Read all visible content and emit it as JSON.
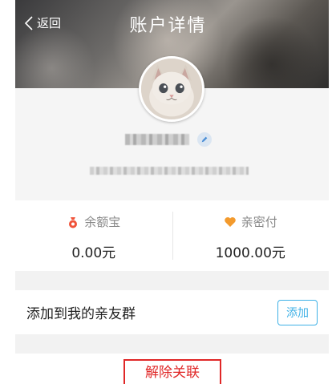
{
  "header": {
    "back_label": "返回",
    "title": "账户详情"
  },
  "stats": [
    {
      "label": "余额宝",
      "value": "0.00元",
      "icon": "moneybag-icon",
      "color": "#f0533a"
    },
    {
      "label": "亲密付",
      "value": "1000.00元",
      "icon": "heart-icon",
      "color": "#f39a2d"
    }
  ],
  "group": {
    "label": "添加到我的亲友群",
    "button_label": "添加"
  },
  "unlink": {
    "label": "解除关联"
  },
  "colors": {
    "accent": "#3fb1e6",
    "danger": "#e02727"
  }
}
